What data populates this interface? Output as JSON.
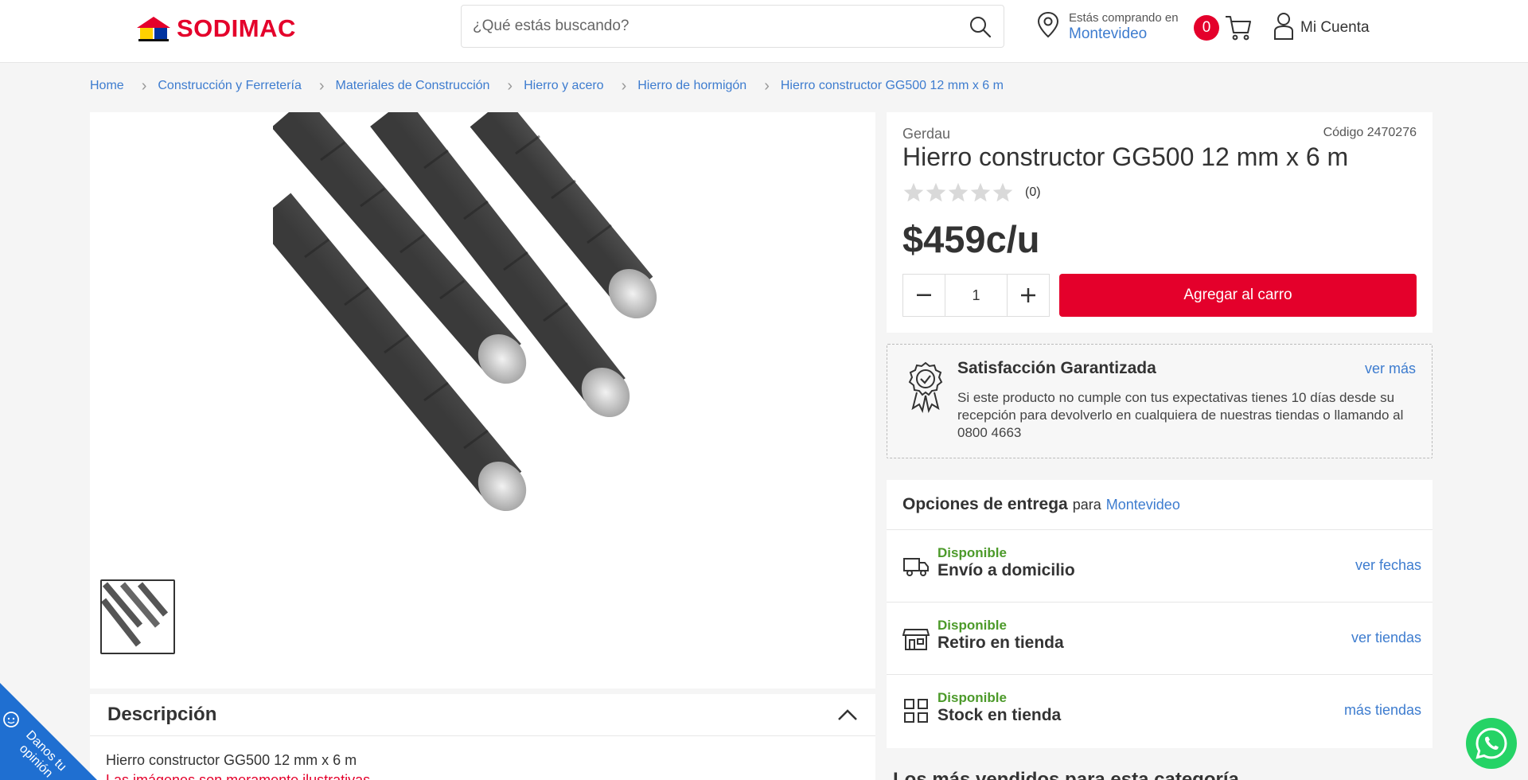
{
  "header": {
    "logo_text": "SODIMAC",
    "search_placeholder": "¿Qué estás buscando?",
    "location_caption": "Estás comprando en",
    "location_city": "Montevideo",
    "cart_count": "0",
    "account_label": "Mi Cuenta"
  },
  "breadcrumb": [
    "Home",
    "Construcción y Ferretería",
    "Materiales de Construcción",
    "Hierro y acero",
    "Hierro de hormigón",
    "Hierro constructor GG500 12 mm x 6 m"
  ],
  "product": {
    "brand": "Gerdau",
    "code": "Código 2470276",
    "title": "Hierro constructor GG500 12 mm x 6 m",
    "rating": 0,
    "reviews": "(0)",
    "price": "$459",
    "unit": "c/u",
    "quantity": "1",
    "add_to_cart": "Agregar al carro"
  },
  "satisfaction": {
    "title": "Satisfacción Garantizada",
    "more": "ver más",
    "text": "Si este producto no cumple con tus expectativas tienes 10 días desde su recepción para devolverlo en cualquiera de nuestras tiendas o llamando al 0800 4663"
  },
  "delivery": {
    "title": "Opciones de entrega",
    "para": "para",
    "city": "Montevideo",
    "options": [
      {
        "status": "Disponible",
        "label": "Envío a domicilio",
        "link": "ver fechas",
        "icon": "truck-icon"
      },
      {
        "status": "Disponible",
        "label": "Retiro en tienda",
        "link": "ver tiendas",
        "icon": "store-icon"
      },
      {
        "status": "Disponible",
        "label": "Stock en tienda",
        "link": "más tiendas",
        "icon": "grid-icon"
      }
    ]
  },
  "description": {
    "title": "Descripción",
    "line1": "Hierro constructor GG500 12 mm x 6 m",
    "line2": "Las imágenes son meramente ilustrativas"
  },
  "feedback": {
    "label": "Danos tu opinión"
  },
  "bottom_peek": "Los más vendidos para esta categoría",
  "colors": {
    "brand_red": "#e4002b",
    "link_blue": "#3d7ccf",
    "available_green": "#4c9a2a",
    "feedback_blue": "#1f6fd1",
    "whatsapp_green": "#25d366"
  }
}
